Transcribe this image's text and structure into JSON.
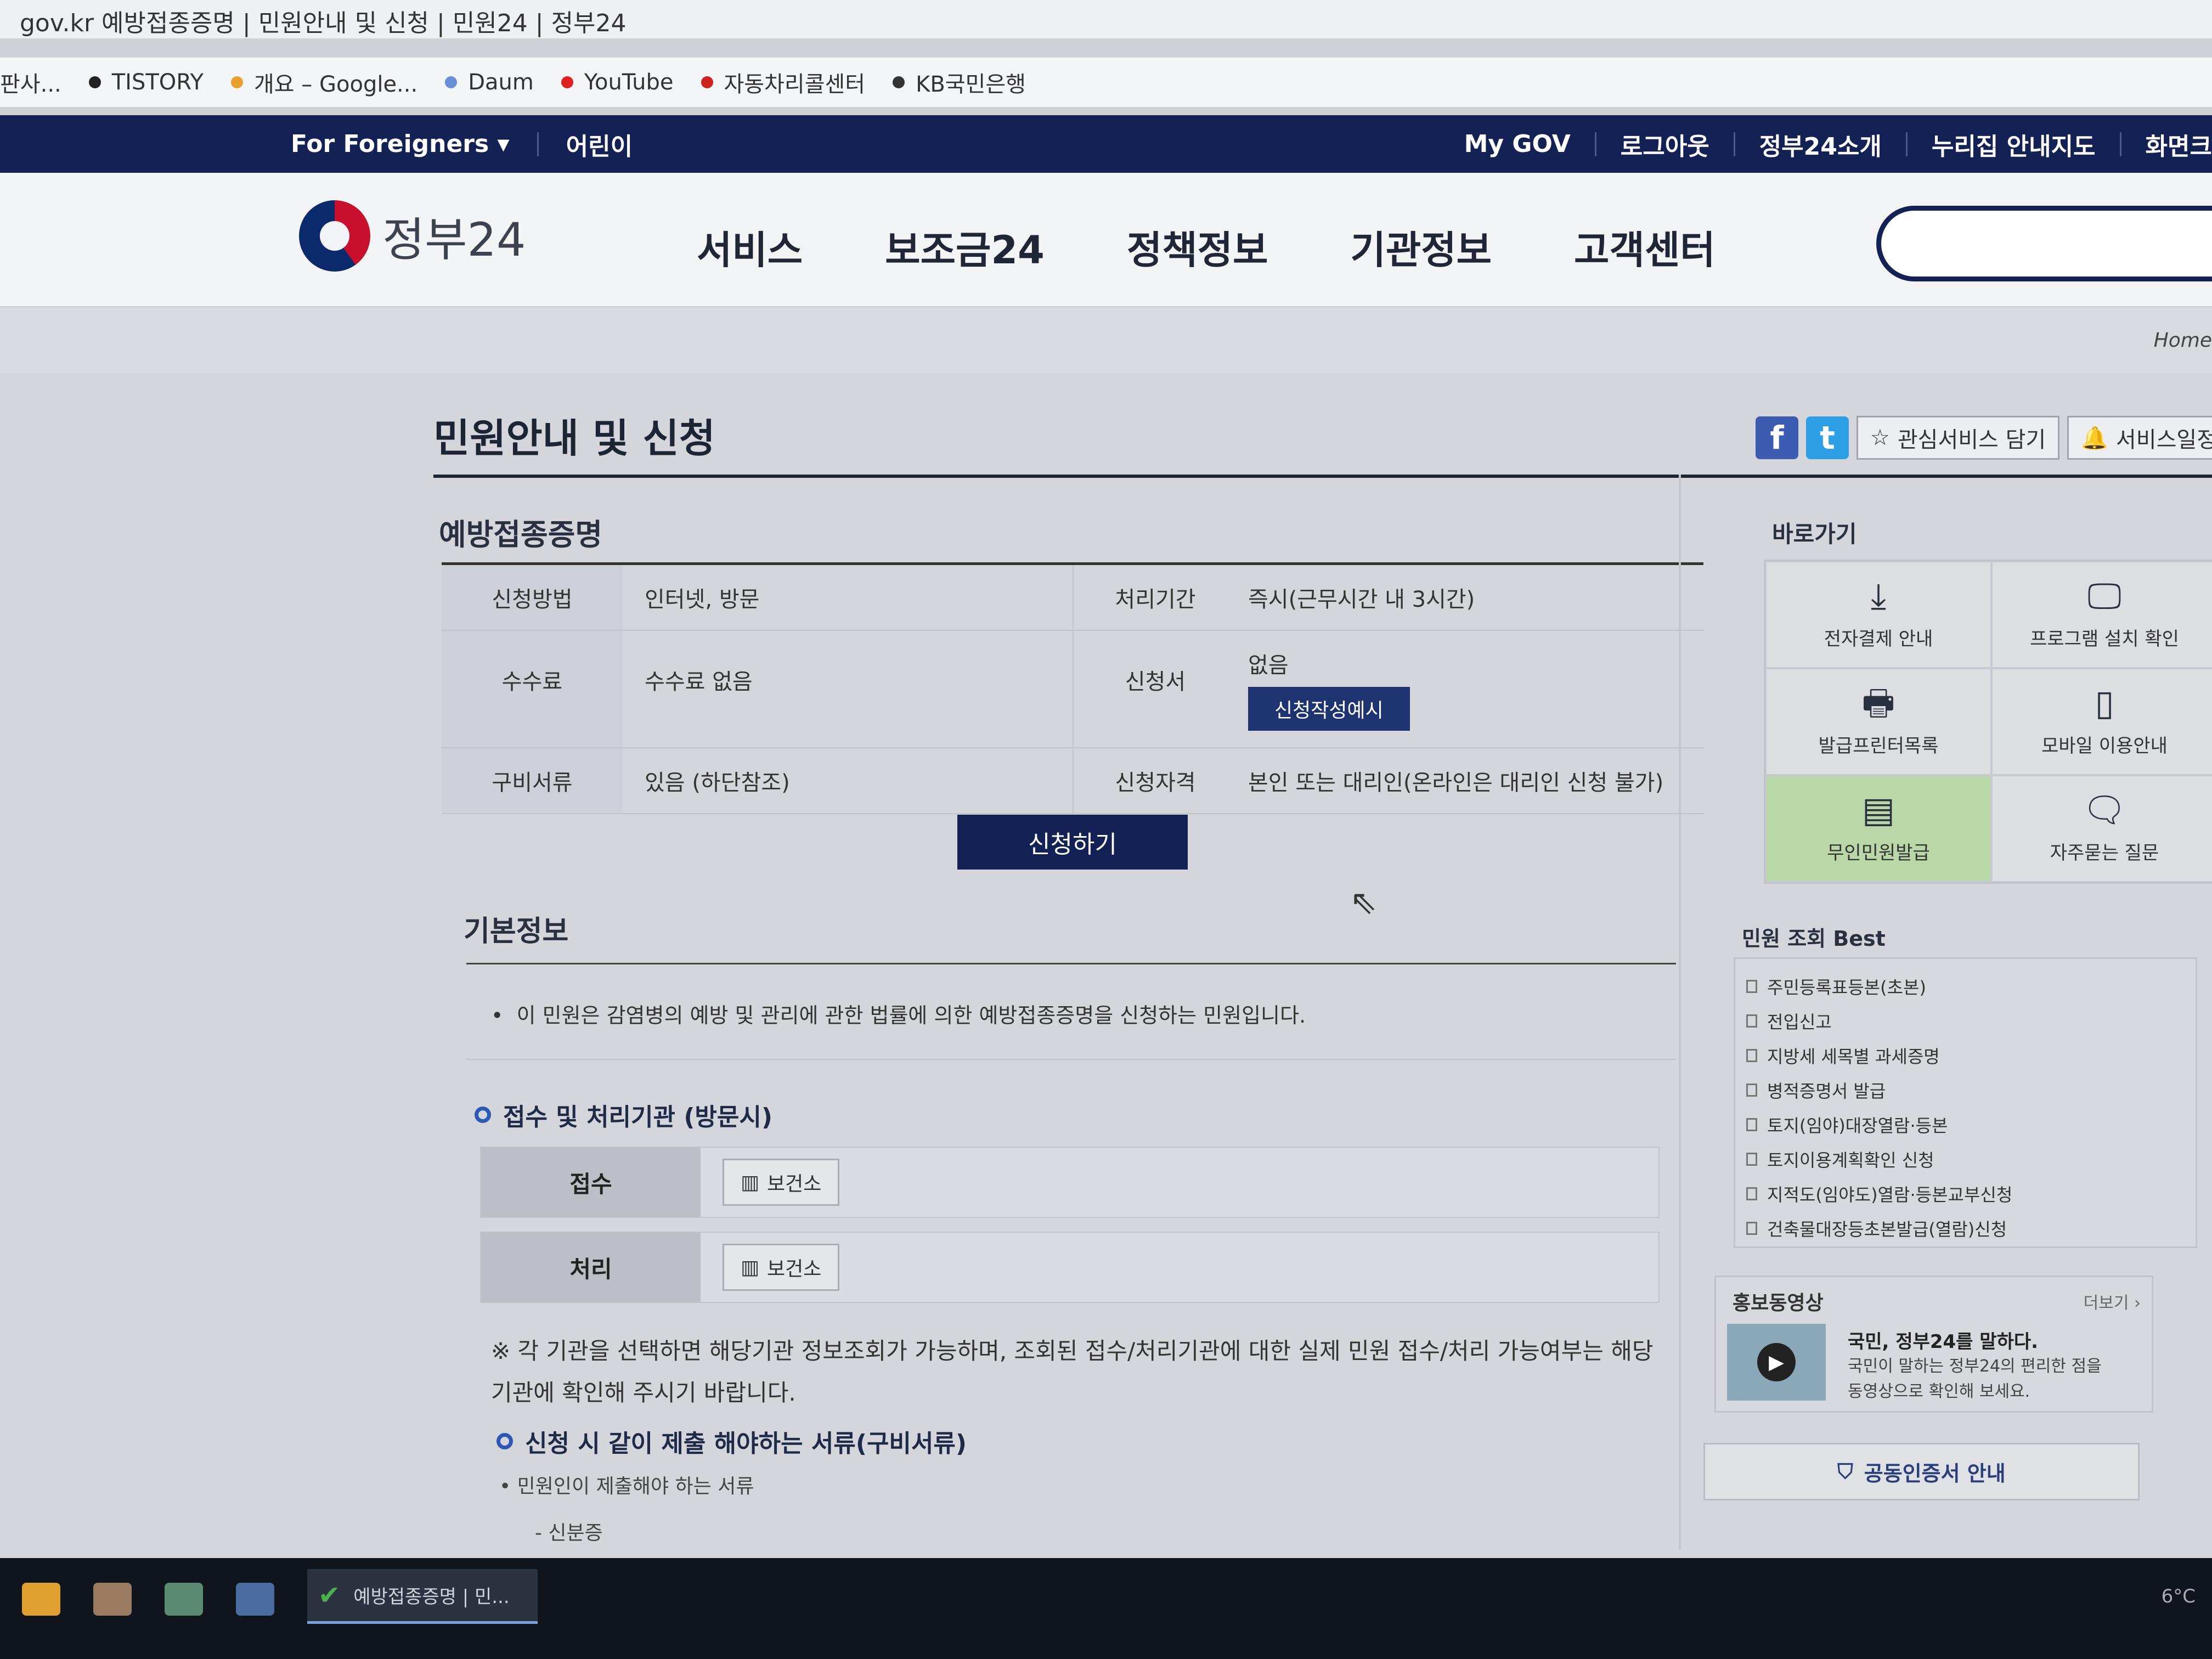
{
  "browser": {
    "title": "gov.kr 예방접종증명 | 민원안내 및 신청 | 민원24 | 정부24",
    "bookmarks": [
      {
        "label": "판사...",
        "color": "#888888"
      },
      {
        "label": "TISTORY",
        "color": "#222222"
      },
      {
        "label": "개요 – Google...",
        "color": "#e8a030"
      },
      {
        "label": "Daum",
        "color": "#6a8fd8"
      },
      {
        "label": "YouTube",
        "color": "#e02020"
      },
      {
        "label": "자동차리콜센터",
        "color": "#d02020"
      },
      {
        "label": "KB국민은행",
        "color": "#333333"
      }
    ]
  },
  "topnav": {
    "foreigners": "For Foreigners ▾",
    "kids": "어린이",
    "right": [
      "My GOV",
      "로그아웃",
      "정부24소개",
      "누리집 안내지도",
      "화면크"
    ]
  },
  "header": {
    "logo": "정부24",
    "menu": [
      "서비스",
      "보조금24",
      "정책정보",
      "기관정보",
      "고객센터"
    ]
  },
  "breadcrumb": {
    "home": "Home"
  },
  "page": {
    "title": "민원안내 및 신청",
    "share": {
      "facebook": "f",
      "twitter": "t",
      "interest": "관심서비스 담기",
      "schedule": "서비스일정 등록"
    },
    "service_name": "예방접종증명",
    "info": [
      {
        "k1": "신청방법",
        "v1": "인터넷, 방문",
        "k2": "처리기간",
        "v2": "즉시(근무시간 내 3시간)"
      },
      {
        "k1": "수수료",
        "v1": "수수료 없음",
        "k2": "신청서",
        "v2": "없음",
        "v2_button": "신청작성예시"
      },
      {
        "k1": "구비서류",
        "v1": "있음 (하단참조)",
        "k2": "신청자격",
        "v2": "본인 또는 대리인(온라인은 대리인 신청 불가)"
      }
    ],
    "apply_button": "신청하기",
    "basic_title": "기본정보",
    "basic_desc": "이 민원은 감염병의 예방 및 관리에 관한 법률에 의한 예방접종증명을 신청하는 민원입니다.",
    "org_head": "접수 및 처리기관 (방문시)",
    "org_rows": [
      {
        "label": "접수",
        "chip": "보건소"
      },
      {
        "label": "처리",
        "chip": "보건소"
      }
    ],
    "note": "※ 각 기관을 선택하면 해당기관 정보조회가 가능하며, 조회된 접수/처리기관에 대한 실제 민원 접수/처리 가능여부는 해당기관에 확인해 주시기 바랍니다.",
    "docs_head": "신청 시 같이 제출 해야하는 서류(구비서류)",
    "docs_sub": "• 민원인이 제출해야 하는 서류",
    "docs_item": "- 신분증"
  },
  "sidebar": {
    "quick_title": "바로가기",
    "quick": [
      {
        "label": "전자결제 안내",
        "icon": "⤓",
        "name": "download-icon"
      },
      {
        "label": "프로그램 설치 확인",
        "icon": "🖵",
        "name": "monitor-icon"
      },
      {
        "label": "발급프린터목록",
        "icon": "🖶",
        "name": "printer-icon"
      },
      {
        "label": "모바일 이용안내",
        "icon": "▯",
        "name": "mobile-icon"
      },
      {
        "label": "무인민원발급",
        "icon": "▤",
        "name": "kiosk-icon"
      },
      {
        "label": "자주묻는 질문",
        "icon": "🗨",
        "name": "faq-icon"
      }
    ],
    "best_title": "민원 조회 Best",
    "best": [
      "주민등록표등본(초본)",
      "전입신고",
      "지방세 세목별 과세증명",
      "병적증명서 발급",
      "토지(임야)대장열람·등본",
      "토지이용계획확인 신청",
      "지적도(임야도)열람·등본교부신청",
      "건축물대장등초본발급(열람)신청"
    ],
    "promo_title": "홍보동영상",
    "promo_more": "더보기 ›",
    "promo_head": "국민, 정부24를 말하다.",
    "promo_desc1": "국민이 말하는 정부24의 편리한 점을",
    "promo_desc2": "동영상으로 확인해 보세요.",
    "cert": "공동인증서 안내"
  },
  "taskbar": {
    "app": "예방접종증명 | 민...",
    "tray": "6°C"
  }
}
